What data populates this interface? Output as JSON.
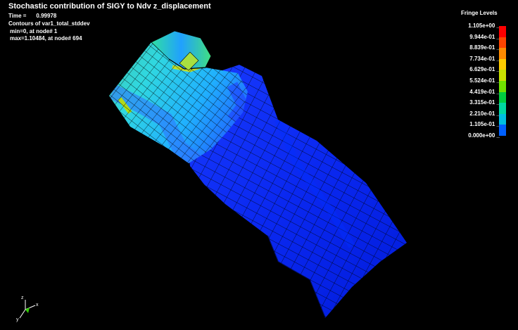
{
  "header": {
    "title": "Stochastic contribution of SIGY to Ndv z_displacement",
    "time_label": "Time =",
    "time_value": "0.99978",
    "contours": "Contours of var1_total_stddev",
    "min": "min=0, at node# 1",
    "max": "max=1.10484, at node# 694"
  },
  "legend": {
    "title": "Fringe Levels",
    "levels": [
      "1.105e+00",
      "9.944e-01",
      "8.839e-01",
      "7.734e-01",
      "6.629e-01",
      "5.524e-01",
      "4.419e-01",
      "3.315e-01",
      "2.210e-01",
      "1.105e-01",
      "0.000e+00"
    ],
    "colors": [
      "#ff0000",
      "#ff4400",
      "#ff8a00",
      "#ffcc00",
      "#c8e000",
      "#70e000",
      "#00cc40",
      "#00d8a0",
      "#00bfe0",
      "#0060ff",
      "#0018e0"
    ]
  },
  "triad": {
    "x": "x",
    "y": "y",
    "z": "z"
  }
}
